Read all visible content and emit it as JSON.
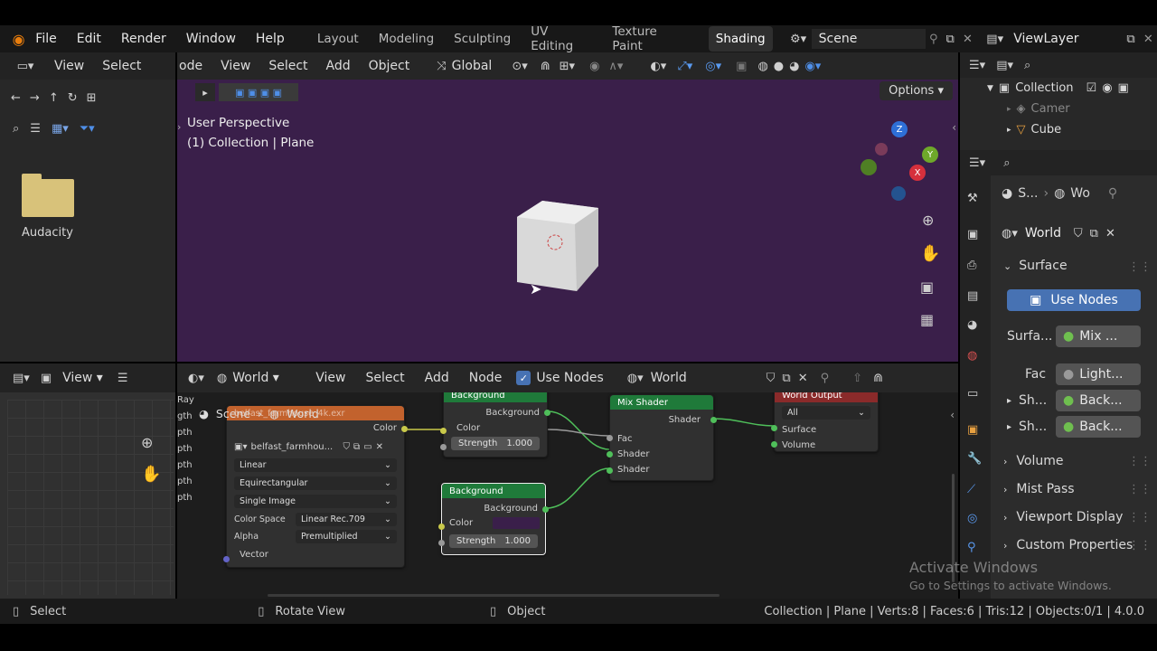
{
  "menu": {
    "file": "File",
    "edit": "Edit",
    "render": "Render",
    "window": "Window",
    "help": "Help"
  },
  "workspaces": [
    "Layout",
    "Modeling",
    "Sculpting",
    "UV Editing",
    "Texture Paint",
    "Shading"
  ],
  "active_workspace": "Shading",
  "scene_label": "Scene",
  "view_layer": "ViewLayer",
  "file_browser": {
    "view": "View",
    "select": "Select",
    "folder_name": "Audacity"
  },
  "viewport": {
    "mode": "ode",
    "view": "View",
    "select": "Select",
    "add": "Add",
    "object": "Object",
    "transform": "Global",
    "options": "Options",
    "perspective": "User Perspective",
    "collection_info": "(1) Collection | Plane",
    "gizmo": {
      "z": "Z",
      "y": "Y",
      "x": "X"
    }
  },
  "outliner": {
    "items": [
      {
        "label": "Collection"
      },
      {
        "label": "Camer"
      },
      {
        "label": "Cube"
      }
    ]
  },
  "properties": {
    "breadcrumb_scene": "S...",
    "breadcrumb_world": "Wo",
    "world_name": "World",
    "surface": "Surface",
    "use_nodes": "Use Nodes",
    "surface_label": "Surfa...",
    "surface_value": "Mix ...",
    "fac_label": "Fac",
    "fac_value": "Light...",
    "sh1_label": "Sh...",
    "sh1_value": "Back...",
    "sh2_label": "Sh...",
    "sh2_value": "Back...",
    "volume": "Volume",
    "mist_pass": "Mist Pass",
    "viewport_display": "Viewport Display",
    "custom_properties": "Custom Properties"
  },
  "image_editor": {
    "view": "View"
  },
  "node_editor": {
    "view": "View",
    "select": "Select",
    "add": "Add",
    "node": "Node",
    "use_nodes": "Use Nodes",
    "type": "World",
    "world": "World",
    "breadcrumb_scene": "Scene",
    "breadcrumb_world": "World",
    "left_labels": [
      "Ray",
      "gth",
      "pth",
      "pth",
      "pth",
      "pth",
      "pth"
    ],
    "env_node": {
      "title": "belfast_farmhouse_4k.exr",
      "out_color": "Color",
      "image": "belfast_farmhou...",
      "interp": "Linear",
      "proj": "Equirectangular",
      "source": "Single Image",
      "color_space_label": "Color Space",
      "color_space": "Linear Rec.709",
      "alpha_label": "Alpha",
      "alpha": "Premultiplied",
      "vector": "Vector"
    },
    "bg1": {
      "title": "Background",
      "out": "Background",
      "color": "Color",
      "strength": "Strength",
      "strength_val": "1.000"
    },
    "bg2": {
      "title": "Background",
      "out": "Background",
      "color": "Color",
      "strength": "Strength",
      "strength_val": "1.000"
    },
    "mix": {
      "title": "Mix Shader",
      "out": "Shader",
      "fac": "Fac",
      "shader1": "Shader",
      "shader2": "Shader"
    },
    "output": {
      "title": "World Output",
      "target": "All",
      "surface": "Surface",
      "volume": "Volume"
    }
  },
  "status_bar": {
    "select": "Select",
    "rotate": "Rotate View",
    "object": "Object",
    "stats": "Collection | Plane | Verts:8 | Faces:6 | Tris:12 | Objects:0/1 | 4.0.0"
  },
  "watermark": {
    "line1": "Activate Windows",
    "line2": "Go to Settings to activate Windows."
  }
}
